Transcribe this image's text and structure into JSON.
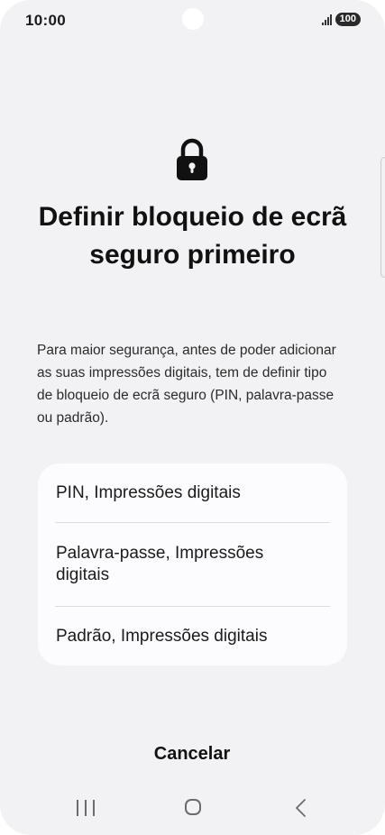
{
  "status_bar": {
    "time": "10:00",
    "battery": "100",
    "icons": [
      "signal-icon",
      "battery-icon",
      "camera-hole"
    ]
  },
  "header": {
    "icon": "lock-icon",
    "title": "Definir bloqueio de ecrã seguro primeiro"
  },
  "description": "Para maior segurança, antes de poder adicionar as suas impressões digitais, tem de definir tipo de bloqueio de ecrã seguro (PIN, palavra-passe ou padrão).",
  "options": [
    {
      "label": "PIN, Impressões digitais"
    },
    {
      "label": "Palavra-passe, Impressões digitais"
    },
    {
      "label": "Padrão, Impressões digitais"
    }
  ],
  "actions": {
    "cancel_label": "Cancelar"
  },
  "nav_bar": {
    "icons": [
      "recents-icon",
      "home-icon",
      "back-icon"
    ]
  },
  "colors": {
    "background": "#f2f2f4",
    "card": "#fcfcfe",
    "text": "#111111"
  }
}
